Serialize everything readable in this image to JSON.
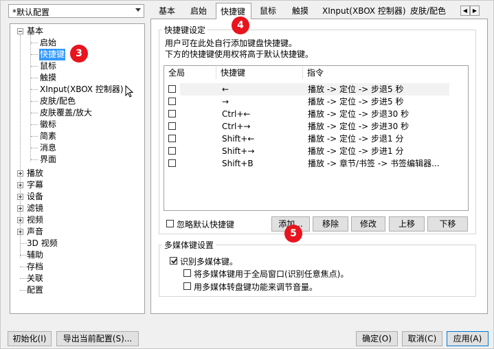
{
  "profile": {
    "value": "*默认配置"
  },
  "tree": {
    "basic": "基本",
    "children": [
      "启始",
      "快捷键",
      "鼠标",
      "触摸",
      "XInput(XBOX 控制器)",
      "皮肤/配色",
      "皮肤覆盖/放大",
      "徽标",
      "简素",
      "消息",
      "界面"
    ],
    "selected_child": "快捷键",
    "collapsed": [
      "播放",
      "字幕",
      "设备",
      "滤镜",
      "视频",
      "声音"
    ],
    "leaves": [
      "3D 视频",
      "辅助",
      "存档",
      "关联",
      "配置"
    ]
  },
  "tabs": [
    "基本",
    "启始",
    "快捷键",
    "鼠标",
    "触摸",
    "XInput(XBOX 控制器)",
    "皮肤/配色"
  ],
  "active_tab": "快捷键",
  "hotkey_group": {
    "title": "快捷键设定",
    "desc1": "用户可在此处自行添加键盘快捷键。",
    "desc2": "下方的快捷键使用权将高于默认快捷键。",
    "columns": [
      "全局",
      "快捷键",
      "指令"
    ],
    "rows": [
      {
        "key": "←",
        "command": "播放 -> 定位 -> 步退5 秒"
      },
      {
        "key": "→",
        "command": "播放 -> 定位 -> 步进5 秒"
      },
      {
        "key": "Ctrl+←",
        "command": "播放 -> 定位 -> 步退30 秒"
      },
      {
        "key": "Ctrl+→",
        "command": "播放 -> 定位 -> 步进30 秒"
      },
      {
        "key": "Shift+←",
        "command": "播放 -> 定位 -> 步退1 分"
      },
      {
        "key": "Shift+→",
        "command": "播放 -> 定位 -> 步进1 分"
      },
      {
        "key": "Shift+B",
        "command": "播放 -> 章节/书签 -> 书签编辑器..."
      }
    ],
    "ignore_default": "忽略默认快捷键",
    "buttons": [
      "添加...",
      "移除",
      "修改",
      "上移",
      "下移"
    ]
  },
  "media_group": {
    "title": "多媒体键设置",
    "recognize": "识别多媒体键。",
    "global_window": "将多媒体键用于全局窗口(识别任意焦点)。",
    "wheel_volume": "用多媒体转盘键功能来调节音量。"
  },
  "footer": {
    "init": "初始化(I)",
    "export": "导出当前配置(S)...",
    "ok": "确定(O)",
    "cancel": "取消(C)",
    "apply": "应用(A)"
  },
  "badges": [
    "3",
    "4",
    "5"
  ],
  "colors": {
    "selection": "#3399ff",
    "badge": "#e8141e",
    "default_button_border": "#0078d7"
  }
}
